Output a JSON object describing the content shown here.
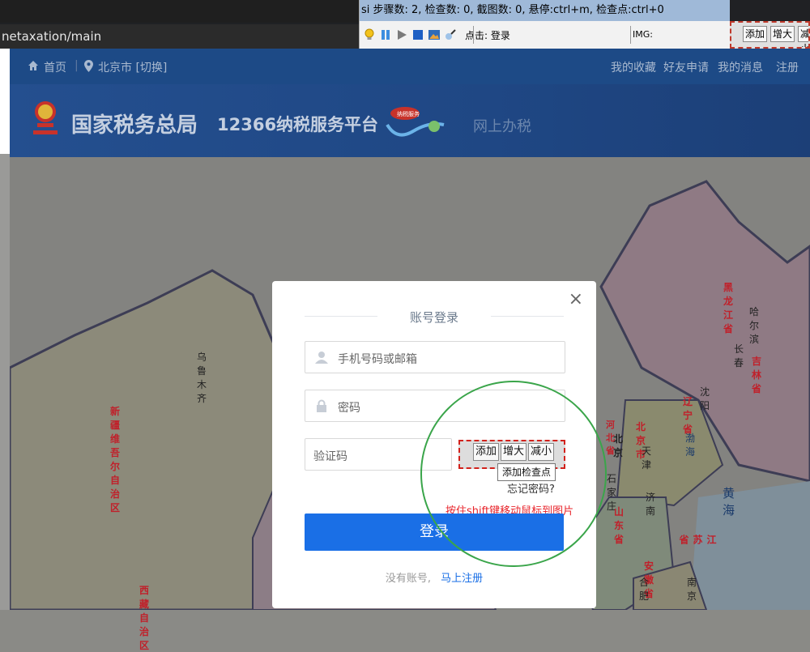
{
  "browser": {
    "address": "netaxation/main"
  },
  "tool": {
    "status": "si 步骤数: 2, 检查数: 0, 截图数: 0, 悬停:ctrl+m, 检查点:ctrl+0",
    "action": "点击: 登录",
    "img_label": "IMG:",
    "mini_buttons": [
      "添加",
      "增大",
      "减小"
    ],
    "icons": [
      "bulb-icon",
      "pause-icon",
      "play-icon",
      "stop-icon",
      "picture-icon",
      "magic-icon"
    ]
  },
  "nav": {
    "home": "首页",
    "location": "北京市 [切换]",
    "links": [
      "我的收藏",
      "好友申请",
      "我的消息",
      "注册"
    ]
  },
  "banner": {
    "org": "国家税务总局",
    "platform": "12366纳税服务平台",
    "online": "网上办税",
    "logo_text": "纳税服务"
  },
  "map": {
    "labels": [
      {
        "text": "乌鲁木齐"
      },
      {
        "text": "新疆维吾尔自治区"
      },
      {
        "text": "西藏自治区"
      },
      {
        "text": "黑龙江省"
      },
      {
        "text": "哈尔滨"
      },
      {
        "text": "长春"
      },
      {
        "text": "吉林省"
      },
      {
        "text": "沈阳"
      },
      {
        "text": "辽宁省"
      },
      {
        "text": "北京市"
      },
      {
        "text": "北京"
      },
      {
        "text": "天津"
      },
      {
        "text": "河北省"
      },
      {
        "text": "石家庄"
      },
      {
        "text": "济南"
      },
      {
        "text": "山东省"
      },
      {
        "text": "黄海"
      },
      {
        "text": "江苏省"
      },
      {
        "text": "安徽省"
      },
      {
        "text": "合肥"
      },
      {
        "text": "南京"
      },
      {
        "text": "渤海"
      }
    ]
  },
  "login": {
    "title": "账号登录",
    "phone_placeholder": "手机号码或邮箱",
    "password_placeholder": "密码",
    "captcha_placeholder": "验证码",
    "captcha_buttons": [
      "添加",
      "增大",
      "减小"
    ],
    "tooltip": "添加检查点",
    "forgot": "忘记密码?",
    "shift_hint": "按住shift键移动鼠标到图片",
    "login_button": "登录",
    "no_account": "没有账号,",
    "register": "马上注册"
  }
}
